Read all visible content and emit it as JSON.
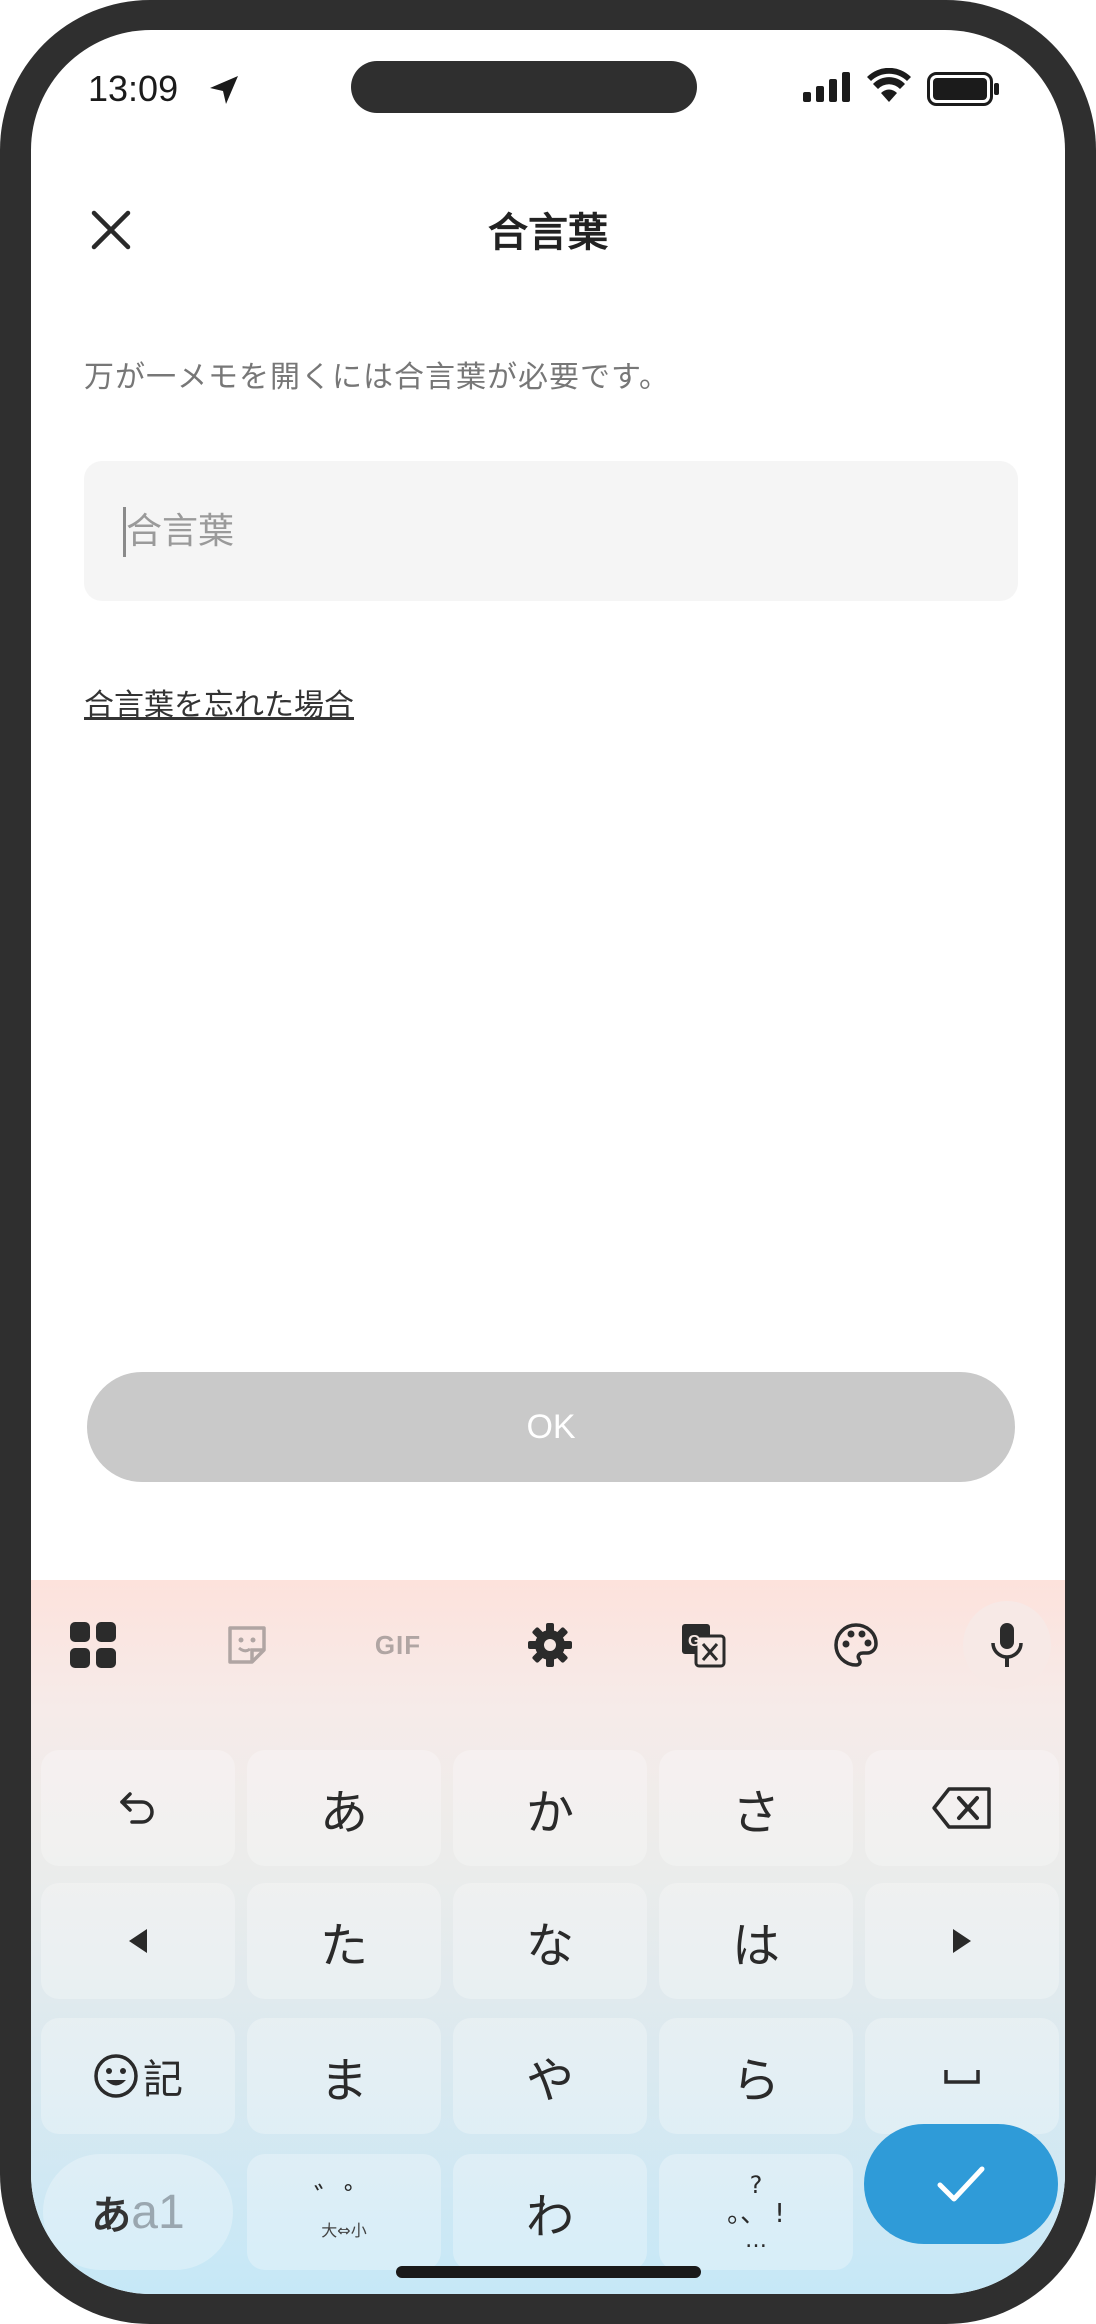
{
  "status_bar": {
    "time": "13:09"
  },
  "header": {
    "title": "合言葉"
  },
  "description": "万が一メモを開くには合言葉が必要です。",
  "passphrase_input": {
    "value": "",
    "placeholder": "合言葉"
  },
  "forgot_link": "合言葉を忘れた場合",
  "ok_button": "OK",
  "keyboard": {
    "toolbar": {
      "gif_label": "GIF"
    },
    "row1": [
      "あ",
      "か",
      "さ"
    ],
    "row2": [
      "た",
      "な",
      "は"
    ],
    "row3": [
      "ま",
      "や",
      "ら"
    ],
    "emoji_key_label": "記",
    "mode_key": {
      "kana": "あ",
      "alpha": "a1"
    },
    "dakuten_key": {
      "top": "゛゜",
      "bottom": "大⇔小"
    },
    "wa_key": "わ",
    "punct_key": {
      "top": "?",
      "middle": "。、 !",
      "bottom": "…"
    }
  },
  "colors": {
    "ok_disabled": "#c9c9c9",
    "enter_key": "#2f9bd8"
  }
}
